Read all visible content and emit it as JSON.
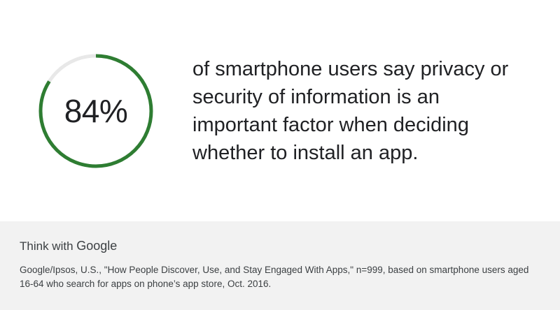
{
  "chart_data": {
    "type": "pie",
    "values": [
      84
    ],
    "max": 100,
    "value_label": "84%",
    "description": "of smartphone users say privacy or security of information is an important factor when deciding whether to install an app."
  },
  "colors": {
    "progress": "#2e7d32",
    "track": "#e8e8e8",
    "footer_background": "#f2f2f2"
  },
  "brand": {
    "prefix": "Think with ",
    "name": "Google"
  },
  "source_note": "Google/Ipsos, U.S., \"How People Discover, Use, and Stay Engaged With Apps,\" n=999, based on smartphone users aged 16-64 who search for apps on phone’s app store, Oct. 2016."
}
